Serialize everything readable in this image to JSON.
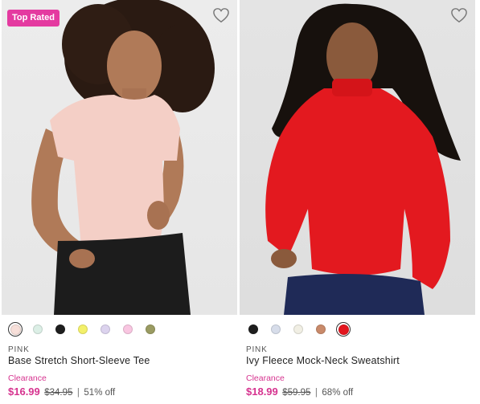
{
  "products": [
    {
      "badge": "Top Rated",
      "brand": "PINK",
      "name": "Base Stretch Short-Sleeve Tee",
      "sale_label": "Clearance",
      "price_now": "$16.99",
      "price_was": "$34.95",
      "discount": "51% off",
      "favorite_icon": "heart-outline-icon",
      "photo_description_colors": {
        "background": "#e8e8e8",
        "top": "#f4cfc6",
        "pants": "#1c1c1c",
        "skin": "#b07a58",
        "hair": "#2a1a12"
      },
      "swatches": [
        {
          "color": "#f7dfd9",
          "selected": true
        },
        {
          "color": "#dcefe6",
          "selected": false
        },
        {
          "color": "#1e1e1e",
          "selected": false
        },
        {
          "color": "#f3f06a",
          "selected": false
        },
        {
          "color": "#dcd3ee",
          "selected": false
        },
        {
          "color": "#f9c6e1",
          "selected": false
        },
        {
          "color": "#9a9b62",
          "selected": false
        }
      ]
    },
    {
      "badge": "",
      "brand": "PINK",
      "name": "Ivy Fleece Mock-Neck Sweatshirt",
      "sale_label": "Clearance",
      "price_now": "$18.99",
      "price_was": "$59.95",
      "discount": "68% off",
      "favorite_icon": "heart-outline-icon",
      "photo_description_colors": {
        "background": "#e1e1e1",
        "top": "#e3191f",
        "pants": "#1f2a57",
        "skin": "#8a5a3c",
        "hair": "#17110d"
      },
      "swatches": [
        {
          "color": "#1e1e1e",
          "selected": false
        },
        {
          "color": "#d7ddea",
          "selected": false
        },
        {
          "color": "#f1efe4",
          "selected": false
        },
        {
          "color": "#c98a6a",
          "selected": false
        },
        {
          "color": "#e3151d",
          "selected": true
        }
      ]
    }
  ],
  "separator": "|"
}
